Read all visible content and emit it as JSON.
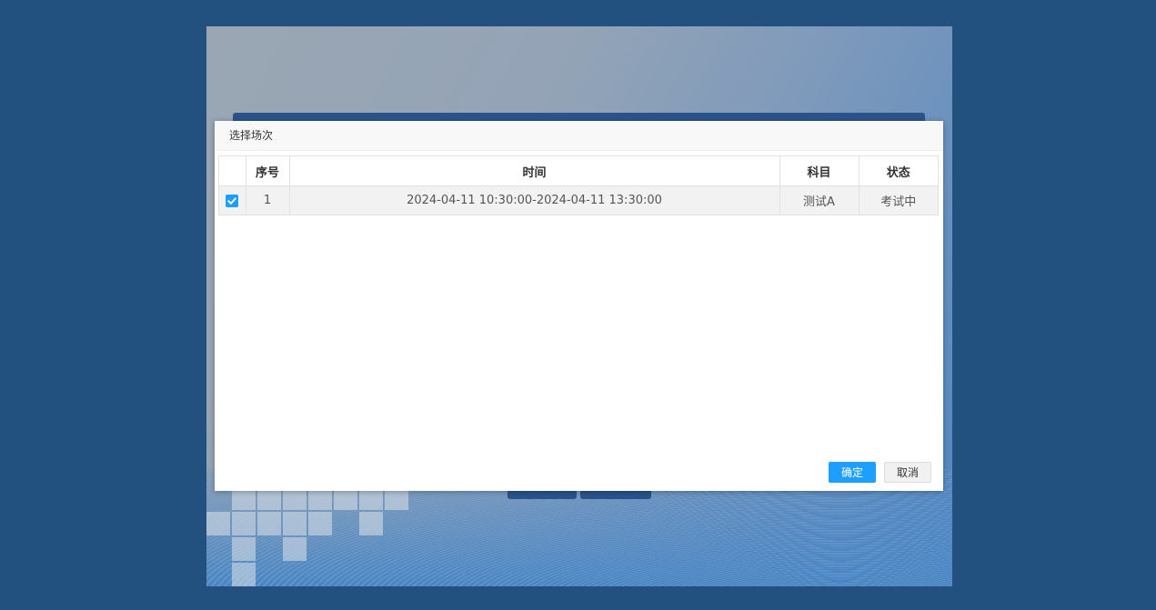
{
  "dialog": {
    "title": "选择场次",
    "table": {
      "headers": {
        "index": "序号",
        "time": "时间",
        "subject": "科目",
        "status": "状态"
      },
      "rows": [
        {
          "checked": true,
          "index": "1",
          "time": "2024-04-11 10:30:00-2024-04-11 13:30:00",
          "subject": "测试A",
          "status": "考试中"
        }
      ]
    },
    "buttons": {
      "confirm": "确定",
      "cancel": "取消"
    }
  },
  "colors": {
    "page_background": "#22507f",
    "primary_button": "#1e9fff",
    "checkbox": "#1e9fff"
  },
  "icons": {
    "checkbox": "check-icon"
  }
}
